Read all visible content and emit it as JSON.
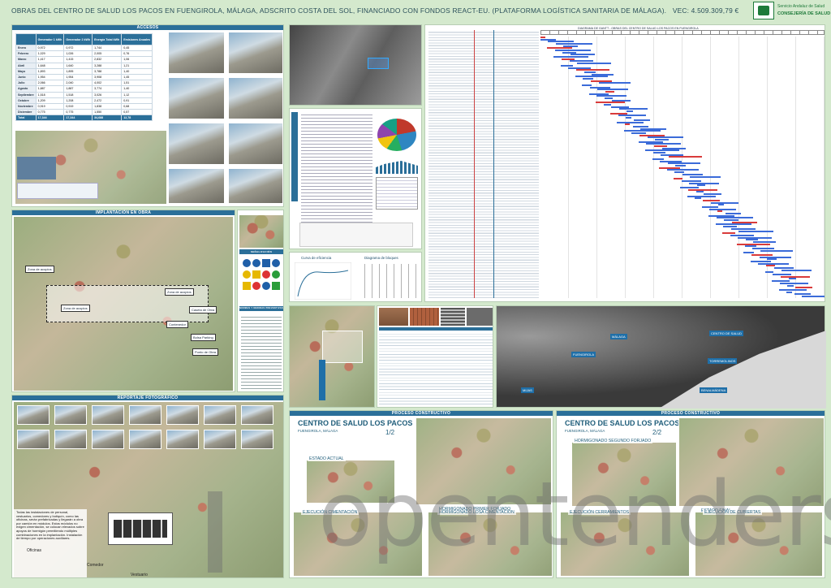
{
  "header": {
    "title": "OBRAS DEL CENTRO DE SALUD LOS PACOS EN FUENGIROLA, MÁLAGA, ADSCRITO COSTA DEL SOL, FINANCIADO CON FONDOS REACT-EU. (PLATAFORMA LOGÍSTICA SANITARIA DE MÁLAGA).",
    "vec": "VEC: 4.509.309,79 €",
    "logo_line1": "Servicio Andaluz de Salud",
    "logo_line2": "CONSEJERÍA DE SALUD"
  },
  "sections": {
    "accesos": "ACCESOS",
    "implantacion": "IMPLANTACIÓN EN OBRA",
    "reportaje": "REPORTAJE FOTOGRÁFICO",
    "proceso_left": "PROCESO CONSTRUCTIVO",
    "proceso_right": "PROCESO CONSTRUCTIVO",
    "gantt_title": "DIAGRAMA DE GANTT - OBRAS DEL CENTRO DE SALUD LOS PACOS EN FUENGIROLA",
    "seguridad": "SEÑALIZACIÓN",
    "normas": "NORMAS Y MEDIDAS PREVENTIVAS"
  },
  "energy_table": {
    "headers": [
      "",
      "Generador 1 kWh",
      "Generador 2 kWh",
      "Energía Total kWh",
      "Emisiones Anuales"
    ],
    "rows": [
      [
        "Enero",
        "0,972",
        "0,972",
        "1,744",
        "0,45"
      ],
      [
        "Febrero",
        "1,029",
        "1,026",
        "2,005",
        "0,76"
      ],
      [
        "Marzo",
        "1,417",
        "1,415",
        "2,832",
        "1,06"
      ],
      [
        "Abril",
        "1,648",
        "1,640",
        "3,288",
        "1,21"
      ],
      [
        "Mayo",
        "1,893",
        "1,895",
        "3,788",
        "1,40"
      ],
      [
        "Junio",
        "1,954",
        "1,954",
        "3,908",
        "1,45"
      ],
      [
        "Julio",
        "2,066",
        "2,040",
        "4,002",
        "1,51"
      ],
      [
        "Agosto",
        "1,887",
        "1,887",
        "3,774",
        "1,40"
      ],
      [
        "Septiembre",
        "1,518",
        "1,518",
        "3,026",
        "1,12"
      ],
      [
        "Octubre",
        "1,209",
        "1,208",
        "2,472",
        "0,91"
      ],
      [
        "Noviembre",
        "0,919",
        "0,919",
        "1,838",
        "0,68"
      ],
      [
        "Diciembre",
        "0,775",
        "0,775",
        "1,550",
        "0,57"
      ],
      [
        "Total",
        "17,344",
        "17,344",
        "34,688",
        "12,78"
      ]
    ]
  },
  "map_labels": {
    "labels": [
      "Zona de acopios",
      "Zona de acopios",
      "Zona de acopios",
      "Caseta de Obra",
      "Contenedor",
      "Caseta de Obra",
      "Caseta de Obra",
      "Zona de acopios",
      "Grúa torre",
      "Grúa torre",
      "Grúa torre",
      "Bolsa Parking",
      "Punto de Obra"
    ]
  },
  "site_text": "Todas las instalaciones de personal, vestuarios, comedores y botiquín, como las oficinas, serán prefabricadas y llegarán a obra por camión en módulos. Estos módulos no exigen cimentación, se colocan elevados sobre apoyos de hormigón permitiendo múltiples combinaciones en la implantación. Instalación de tiempo por operaciones auxiliares.",
  "module_labels": [
    "Oficinas",
    "Comedor",
    "Vestuario"
  ],
  "process": {
    "title": "CENTRO DE SALUD LOS PACOS",
    "subtitle": "FUENGIROLA, MÁLAGA",
    "page_left": "1/2",
    "page_right": "2/2",
    "stages_left": [
      {
        "name": "ESTADO ACTUAL"
      },
      {
        "name": "HORMIGONADO",
        "detail": "PRIMER FORJADO"
      },
      {
        "name": "EJECUCIÓN",
        "detail": "CIMENTACIÓN"
      },
      {
        "name": "HORMIGONADO",
        "detail": "LOSA CIMENTACIÓN"
      }
    ],
    "stages_right": [
      {
        "name": "HORMIGONADO",
        "detail": "SEGUNDO FORJADO"
      },
      {
        "name": "ESTADO FINAL"
      },
      {
        "name": "EJECUCIÓN",
        "detail": "CERRAMIENTOS"
      },
      {
        "name": "EJECUCIÓN",
        "detail": "DE CUBIERTAS"
      }
    ]
  },
  "area_labels": [
    "MÁLAGA",
    "FUENGIROLA",
    "MIJAS",
    "FUENGIROLA",
    "CENTRO DE SALUD",
    "TORREMOLINOS",
    "BENALMÁDENA"
  ],
  "charts": {
    "curve_title": "Curva de eficiencia",
    "block_title": "Diagrama de bloques"
  },
  "watermark": "opentenders",
  "colors": {
    "background": "#d4e9cd",
    "band": "#2b6f99",
    "gantt_red": "#d93b3b",
    "gantt_blue": "#3b6bd9"
  }
}
